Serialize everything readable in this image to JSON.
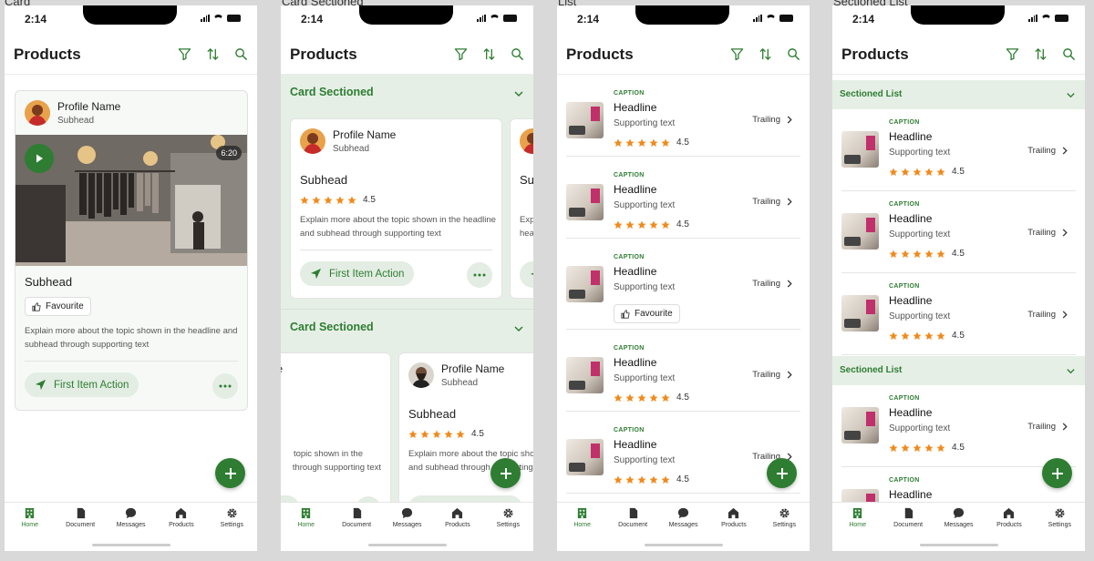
{
  "frames": [
    "Card",
    "Card Sectioned",
    "List",
    "Sectioned List"
  ],
  "status": {
    "time": "2:14"
  },
  "header": {
    "title": "Products"
  },
  "tabs": [
    "Home",
    "Document",
    "Messages",
    "Products",
    "Settings"
  ],
  "card": {
    "profile_name": "Profile Name",
    "profile_subhead": "Subhead",
    "duration": "6:20",
    "subhead": "Subhead",
    "favourite": "Favourite",
    "body": "Explain more about the topic shown in the headline and subhead through supporting text",
    "action": "First Item Action"
  },
  "sectioned": {
    "section_title": "Card Sectioned",
    "profile_name": "Profile Name",
    "profile_subhead": "Subhead",
    "subhead": "Subhead",
    "rating": "4.5",
    "body": "Explain more about the topic shown in the headline and subhead through supporting text",
    "action": "First Item Action",
    "partial_body_1": "topic shown in the",
    "partial_body_2": "through supporting text",
    "partial_subhead": "Su",
    "partial_body_3": "Exp",
    "partial_body_4": "hea",
    "partial_title": "e",
    "partial_action": "ion"
  },
  "list": {
    "caption": "CAPTION",
    "headline": "Headline",
    "supporting": "Supporting text",
    "trailing": "Trailing",
    "rating": "4.5",
    "favourite": "Favourite"
  },
  "sectioned_list": {
    "section_title": "Sectioned List"
  },
  "colors": {
    "accent": "#2e7d32",
    "accent_light": "#e6efe6",
    "star": "#f08a1c"
  }
}
